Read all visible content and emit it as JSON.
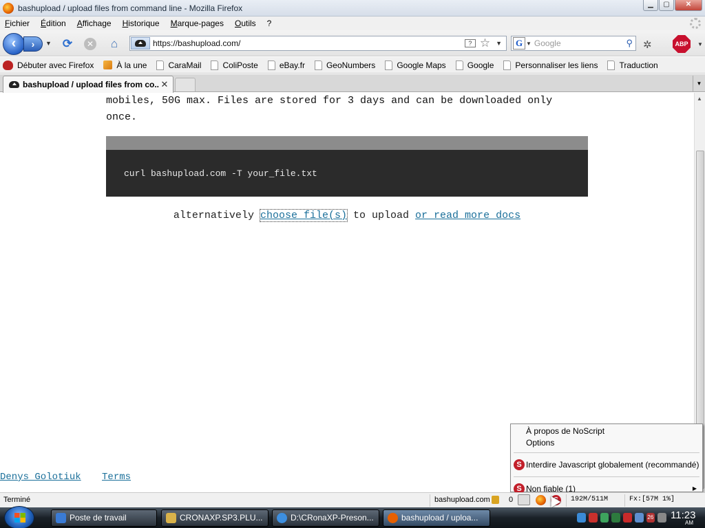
{
  "window": {
    "title": "bashupload / upload files from command line - Mozilla Firefox",
    "buttons": {
      "minimize": "▁",
      "maximize": "▢",
      "close": "✕"
    }
  },
  "menubar": {
    "items": [
      "Fichier",
      "Édition",
      "Affichage",
      "Historique",
      "Marque-pages",
      "Outils",
      "?"
    ]
  },
  "navbar": {
    "url": "https://bashupload.com/",
    "search_placeholder": "Google",
    "search_engine_letter": "G",
    "adblock_label": "ABP",
    "url_help_label": "?"
  },
  "bookmarks": [
    {
      "label": "Débuter avec Firefox",
      "icon": "firefox-icon"
    },
    {
      "label": "À la une",
      "icon": "rss-icon"
    },
    {
      "label": "CaraMail",
      "icon": "page-icon"
    },
    {
      "label": "ColiPoste",
      "icon": "page-icon"
    },
    {
      "label": "eBay.fr",
      "icon": "page-icon"
    },
    {
      "label": "GeoNumbers",
      "icon": "page-icon"
    },
    {
      "label": "Google Maps",
      "icon": "page-icon"
    },
    {
      "label": "Google",
      "icon": "page-icon"
    },
    {
      "label": "Personnaliser les liens",
      "icon": "page-icon"
    },
    {
      "label": "Traduction",
      "icon": "page-icon"
    }
  ],
  "tabs": [
    {
      "label": "bashupload / upload files from co...",
      "close": "✕"
    }
  ],
  "content": {
    "description": "mobiles, 50G max. Files are stored for 3 days and can be downloaded only once.",
    "command": "curl bashupload.com -T your_file.txt",
    "alt_prefix": "alternatively",
    "choose_link": "choose file(s)",
    "alt_middle": "to upload",
    "docs_link": "or read more docs",
    "footer": {
      "author": "Denys Golotiuk",
      "terms": "Terms"
    }
  },
  "context_menu": {
    "about": "À propos de NoScript",
    "options": "Options",
    "forbid_js": "Interdire Javascript globalement (recommandé)",
    "untrusted": "Non fiable (1)"
  },
  "statusbar": {
    "text": "Terminé",
    "site": "bashupload.com",
    "count": "0",
    "memory": "192M/511M",
    "fx": "Fx:[57M  1%]"
  },
  "taskbar": {
    "tasks": [
      {
        "label": "Poste de travail",
        "color": "#3a7bd5"
      },
      {
        "label": "CRONAXP.SP3.PLU...",
        "color": "#d9b24a"
      },
      {
        "label": "D:\\CRonaXP-Preson...",
        "color": "#3d8fe0"
      },
      {
        "label": "bashupload / uploa...",
        "color": "#e66000"
      }
    ],
    "tray_badge": "26",
    "clock": "11:23",
    "ampm": "AM"
  },
  "colors": {
    "link": "#1a6f9a",
    "code_bg": "#2b2b2b",
    "code_header": "#8c8c8c",
    "noscript_red": "#c21f2a"
  }
}
